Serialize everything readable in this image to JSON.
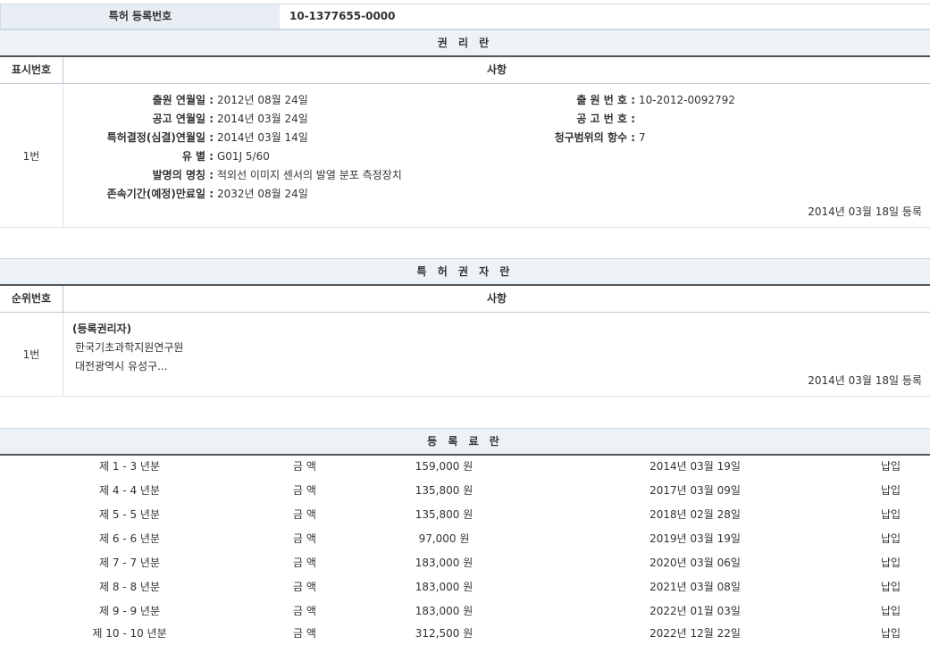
{
  "registration": {
    "label": "특허 등록번호",
    "value": "10-1377655-0000"
  },
  "rights": {
    "title": "권 리 란",
    "headers": {
      "index": "표시번호",
      "content": "사항"
    },
    "row": {
      "index": "1번",
      "left": [
        {
          "label": "출원 연월일 :",
          "value": "2012년 08월 24일"
        },
        {
          "label": "공고 연월일 :",
          "value": "2014년 03월 24일"
        },
        {
          "label": "특허결정(심결)연월일 :",
          "value": "2014년 03월 14일"
        },
        {
          "label": "유 별 :",
          "value": "G01J 5/60"
        },
        {
          "label": "발명의 명칭 :",
          "value": "적외선 이미지 센서의 발열 분포 측정장치"
        },
        {
          "label": "존속기간(예정)만료일 :",
          "value": "2032년 08월 24일"
        }
      ],
      "right": [
        {
          "label": "출 원 번 호 :",
          "value": "10-2012-0092792"
        },
        {
          "label": "공 고 번 호 :",
          "value": ""
        },
        {
          "label": "청구범위의 항수 :",
          "value": "7"
        }
      ],
      "reg_date": "2014년 03월 18일 등록"
    }
  },
  "holders": {
    "title": "특 허 권 자 란",
    "headers": {
      "index": "순위번호",
      "content": "사항"
    },
    "row": {
      "index": "1번",
      "tag": "(등록권리자)",
      "name": "한국기초과학지원연구원",
      "address": "대전광역시 유성구...",
      "reg_date": "2014년 03월 18일 등록"
    }
  },
  "fees": {
    "title": "등 록 료 란",
    "rows": [
      {
        "year": "제 1 - 3 년분",
        "label": "금 액",
        "amount": "159,000 원",
        "date": "2014년 03월 19일",
        "status": "납입"
      },
      {
        "year": "제 4 - 4 년분",
        "label": "금 액",
        "amount": "135,800 원",
        "date": "2017년 03월 09일",
        "status": "납입"
      },
      {
        "year": "제 5 - 5 년분",
        "label": "금 액",
        "amount": "135,800 원",
        "date": "2018년 02월 28일",
        "status": "납입"
      },
      {
        "year": "제 6 - 6 년분",
        "label": "금 액",
        "amount": "97,000 원",
        "date": "2019년 03월 19일",
        "status": "납입"
      },
      {
        "year": "제 7 - 7 년분",
        "label": "금 액",
        "amount": "183,000 원",
        "date": "2020년 03월 06일",
        "status": "납입"
      },
      {
        "year": "제 8 - 8 년분",
        "label": "금 액",
        "amount": "183,000 원",
        "date": "2021년 03월 08일",
        "status": "납입"
      },
      {
        "year": "제 9 - 9 년분",
        "label": "금 액",
        "amount": "183,000 원",
        "date": "2022년 01월 03일",
        "status": "납입"
      },
      {
        "year": "제 10 - 10 년분",
        "label": "금 액",
        "amount": "312,500 원",
        "date": "2022년 12월 22일",
        "status": "납입"
      }
    ]
  }
}
